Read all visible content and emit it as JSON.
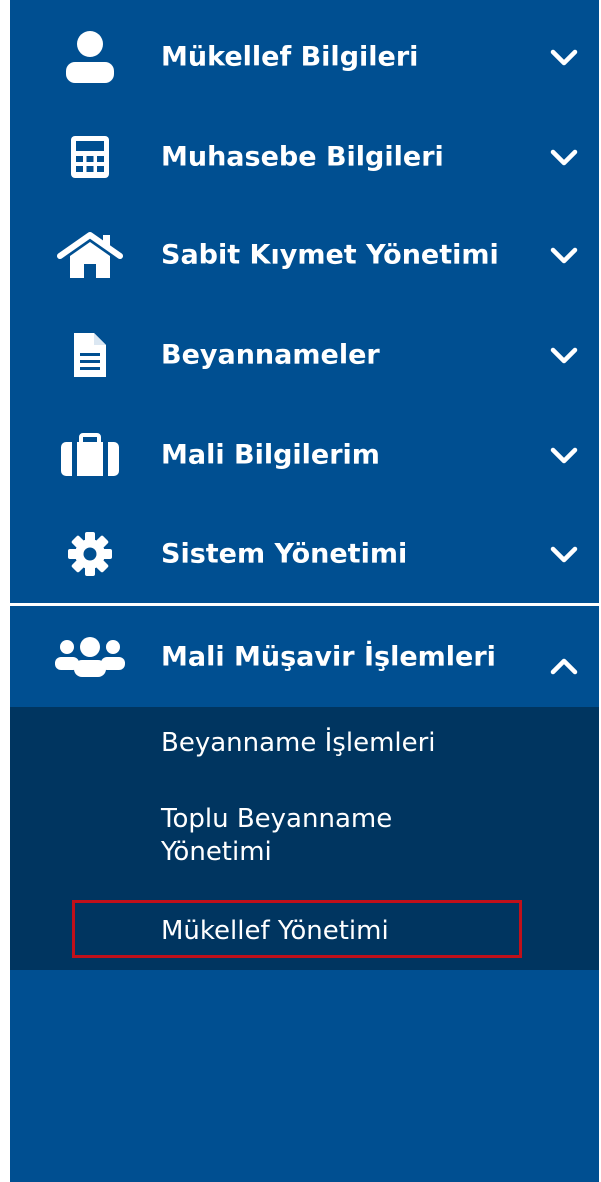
{
  "menu": [
    {
      "label": "Mükellef Bilgileri",
      "icon": "user-icon",
      "expanded": false
    },
    {
      "label": "Muhasebe Bilgileri",
      "icon": "calculator-icon",
      "expanded": false
    },
    {
      "label": "Sabit Kıymet Yönetimi",
      "icon": "home-icon",
      "expanded": false
    },
    {
      "label": "Beyannameler",
      "icon": "document-icon",
      "expanded": false
    },
    {
      "label": "Mali Bilgilerim",
      "icon": "briefcase-icon",
      "expanded": false
    },
    {
      "label": "Sistem Yönetimi",
      "icon": "gear-icon",
      "expanded": false
    },
    {
      "label": "Mali Müşavir İşlemleri",
      "icon": "users-icon",
      "expanded": true
    }
  ],
  "submenu": [
    {
      "label": "Beyanname İşlemleri"
    },
    {
      "label": "Toplu Beyanname Yönetimi"
    },
    {
      "label": "Mükellef Yönetimi",
      "highlighted": true
    }
  ],
  "colors": {
    "sidebar_bg": "#004f91",
    "submenu_bg": "#003560",
    "text": "#ffffff",
    "highlight_border": "#c0101a"
  }
}
